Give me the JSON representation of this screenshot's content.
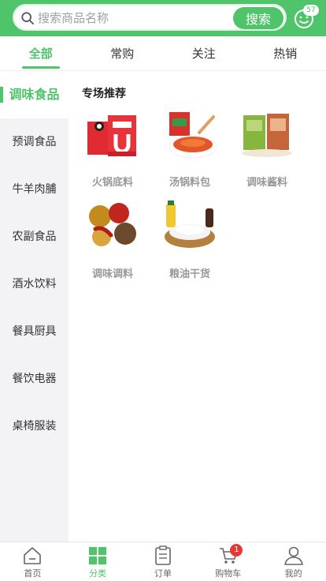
{
  "header": {
    "search_placeholder": "搜索商品名称",
    "search_button": "搜索",
    "message_count": "57"
  },
  "tabs": [
    {
      "label": "全部",
      "active": true
    },
    {
      "label": "常购",
      "active": false
    },
    {
      "label": "关注",
      "active": false
    },
    {
      "label": "热销",
      "active": false
    }
  ],
  "sidebar": {
    "items": [
      {
        "label": "调味食品",
        "active": true
      },
      {
        "label": "预调食品",
        "active": false
      },
      {
        "label": "牛羊肉脯",
        "active": false
      },
      {
        "label": "农副食品",
        "active": false
      },
      {
        "label": "酒水饮料",
        "active": false
      },
      {
        "label": "餐具厨具",
        "active": false
      },
      {
        "label": "餐饮电器",
        "active": false
      },
      {
        "label": "桌椅服装",
        "active": false
      }
    ]
  },
  "main": {
    "section_title": "专场推荐",
    "products": [
      {
        "label": "火锅底料",
        "icon": "hotpot-base-image"
      },
      {
        "label": "汤锅料包",
        "icon": "soup-pack-image"
      },
      {
        "label": "调味酱料",
        "icon": "sauce-image"
      },
      {
        "label": "调味调料",
        "icon": "spices-image"
      },
      {
        "label": "粮油干货",
        "icon": "grain-oil-image"
      }
    ]
  },
  "bottom_nav": {
    "items": [
      {
        "label": "首页",
        "icon": "home-icon",
        "active": false
      },
      {
        "label": "分类",
        "icon": "category-icon",
        "active": true
      },
      {
        "label": "订单",
        "icon": "order-icon",
        "active": false
      },
      {
        "label": "购物车",
        "icon": "cart-icon",
        "active": false
      },
      {
        "label": "我的",
        "icon": "profile-icon",
        "active": false
      }
    ],
    "cart_count": "1"
  },
  "colors": {
    "accent": "#4fc46a",
    "badge": "#e53935"
  }
}
